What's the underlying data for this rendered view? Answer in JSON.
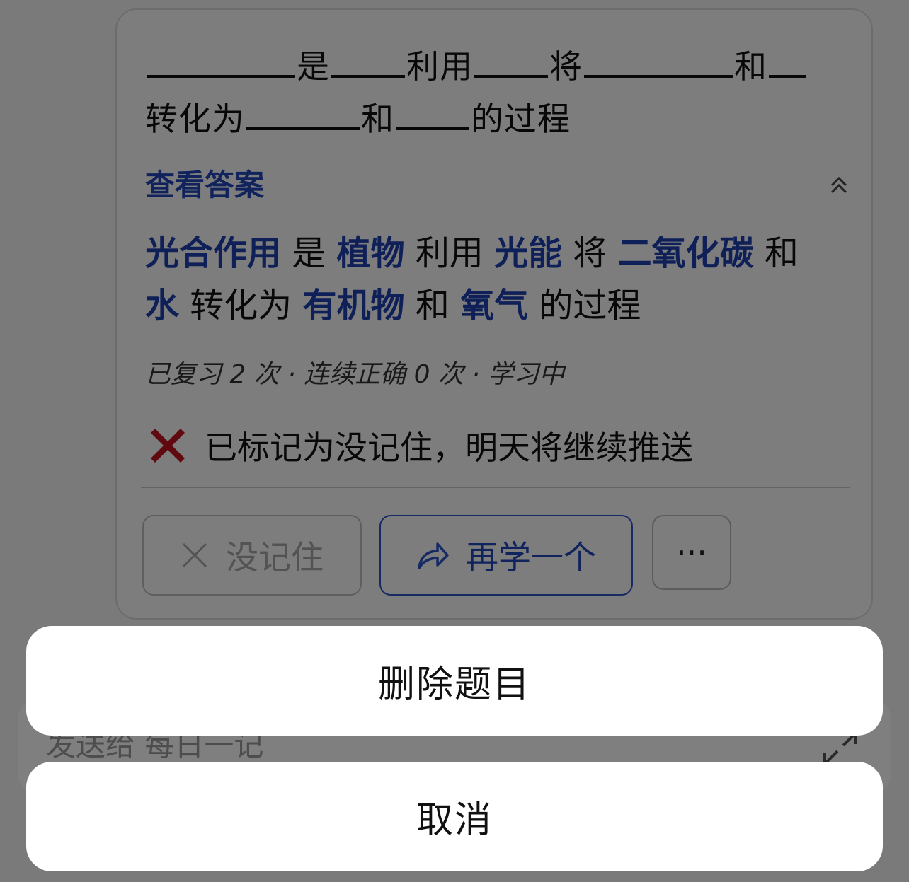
{
  "question": {
    "line1": [
      "是",
      "利用",
      "将",
      "和"
    ],
    "line2": [
      "转化为",
      "和",
      "的过程"
    ]
  },
  "answer_toggle": "查看答案",
  "answer": {
    "line1": [
      {
        "t": "光合作用",
        "k": true
      },
      {
        "t": " 是 ",
        "k": false
      },
      {
        "t": "植物",
        "k": true
      },
      {
        "t": " 利用 ",
        "k": false
      },
      {
        "t": "光能",
        "k": true
      },
      {
        "t": " 将 ",
        "k": false
      },
      {
        "t": "二氧化碳",
        "k": true
      },
      {
        "t": " 和",
        "k": false
      }
    ],
    "line2": [
      {
        "t": "水",
        "k": true
      },
      {
        "t": " 转化为 ",
        "k": false
      },
      {
        "t": "有机物",
        "k": true
      },
      {
        "t": " 和 ",
        "k": false
      },
      {
        "t": "氧气",
        "k": true
      },
      {
        "t": " 的过程",
        "k": false
      }
    ]
  },
  "stats": "已复习 2 次 · 连续正确 0 次 · 学习中",
  "status_text": "已标记为没记住，明天将继续推送",
  "buttons": {
    "forgot": "没记住",
    "next": "再学一个",
    "more": "···"
  },
  "input": {
    "placeholder": "发送给 每日一记"
  },
  "sheet": {
    "delete": "删除题目",
    "cancel": "取消"
  },
  "colors": {
    "accent": "#2046b8",
    "wrong": "#c0121c"
  },
  "icons": [
    "chevron-up-double-icon",
    "red-x-icon",
    "close-icon",
    "share-arrow-icon",
    "more-icon",
    "expand-icon"
  ]
}
